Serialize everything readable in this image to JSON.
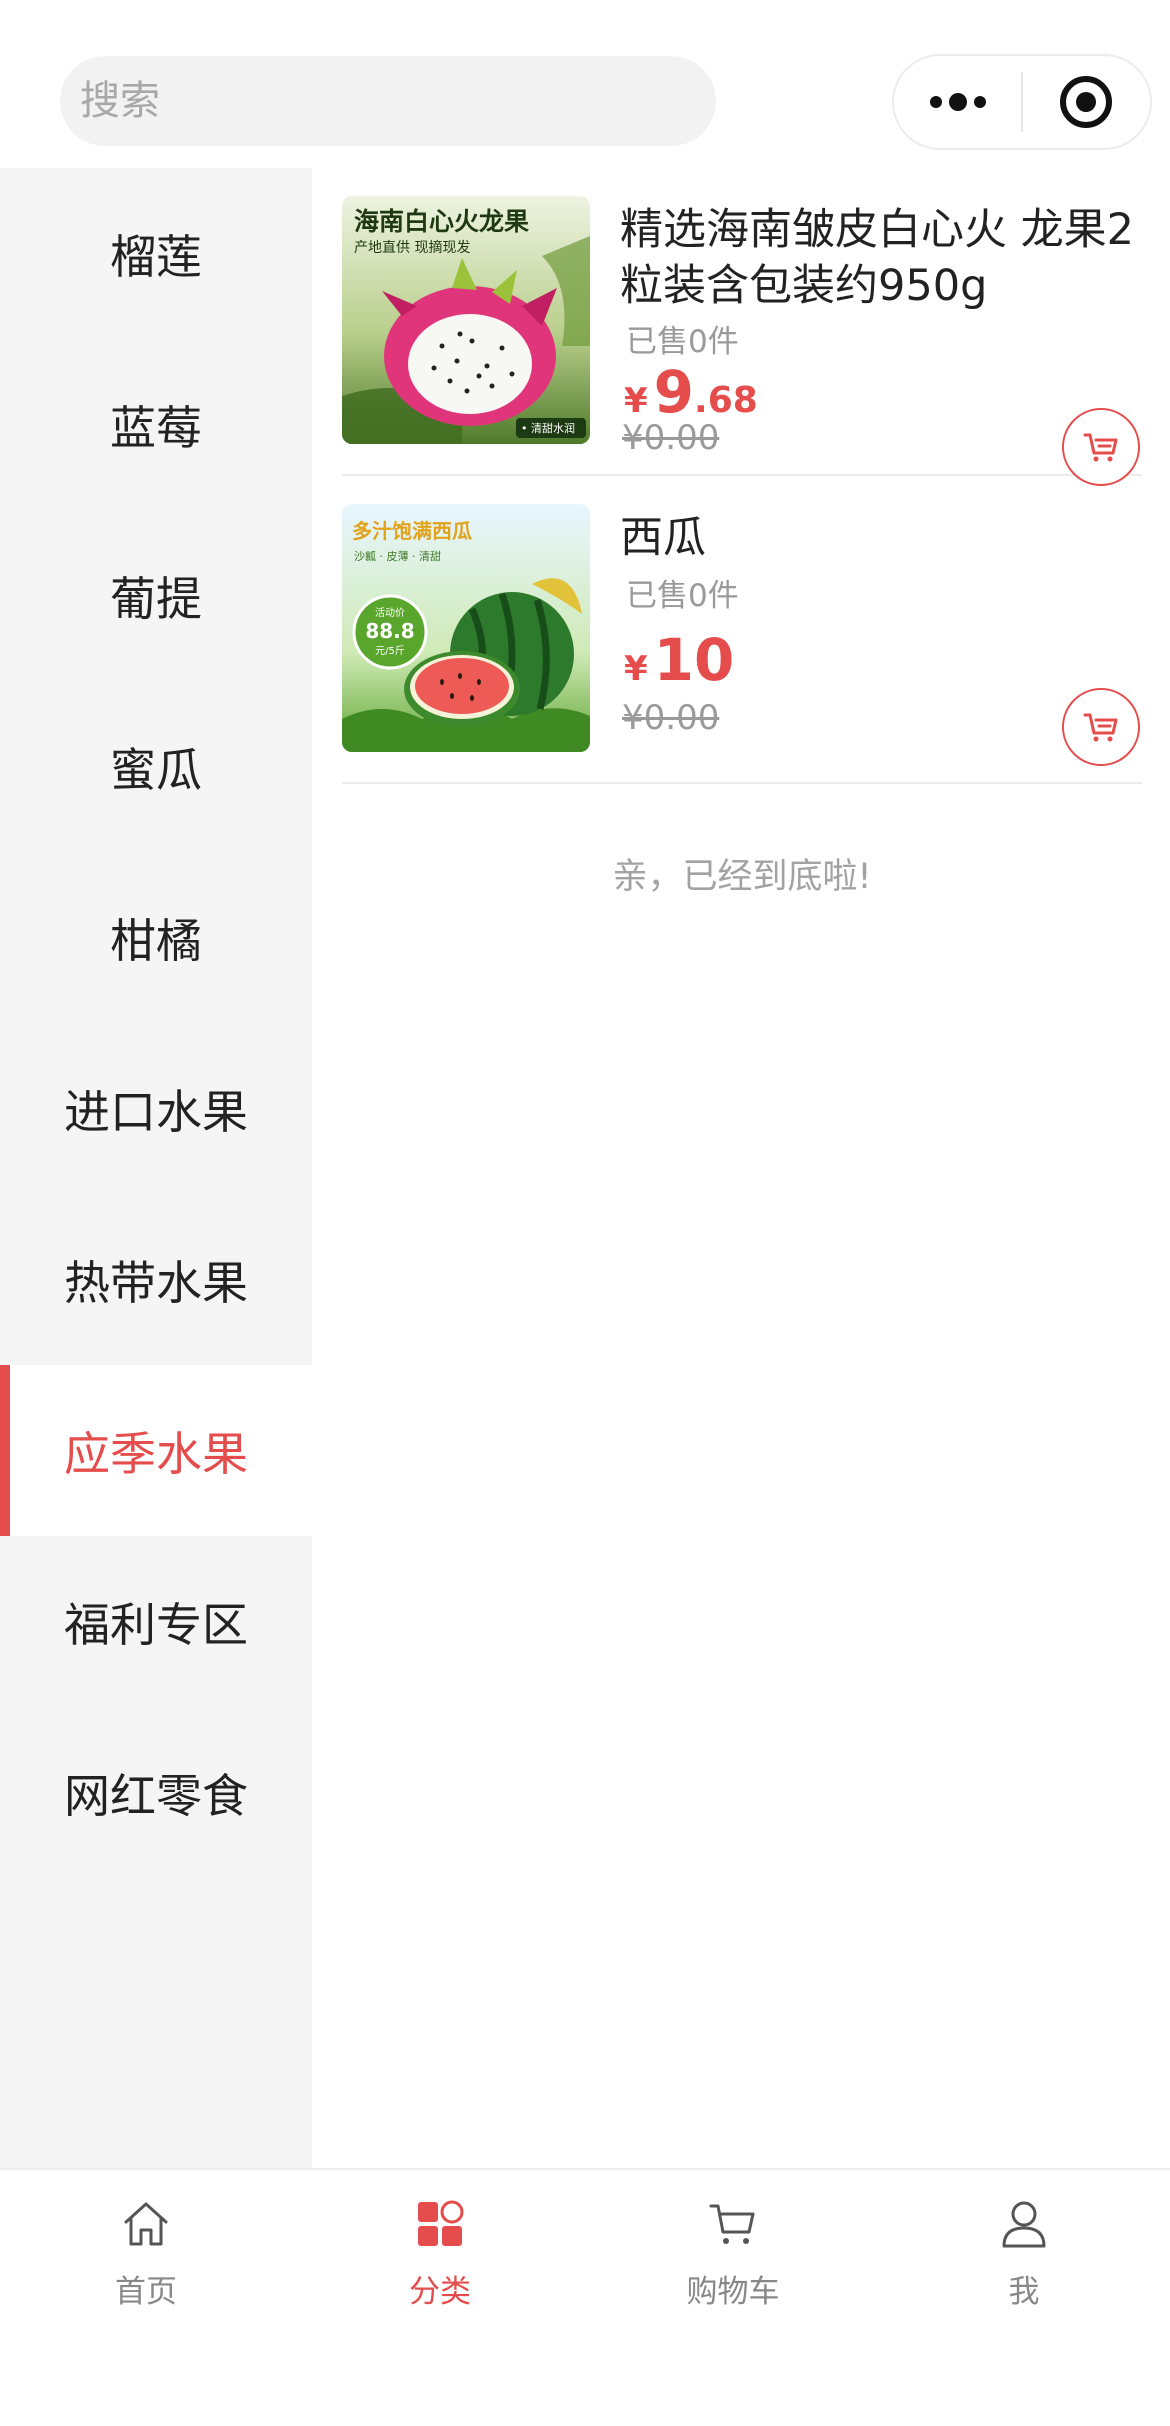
{
  "search": {
    "placeholder": "搜索"
  },
  "sidebar": {
    "items": [
      {
        "label": "榴莲"
      },
      {
        "label": "蓝莓"
      },
      {
        "label": "葡提"
      },
      {
        "label": "蜜瓜"
      },
      {
        "label": "柑橘"
      },
      {
        "label": "进口水果"
      },
      {
        "label": "热带水果"
      },
      {
        "label": "应季水果"
      },
      {
        "label": "福利专区"
      },
      {
        "label": "网红零食"
      }
    ],
    "active_label": "应季水果"
  },
  "products": [
    {
      "title": "精选海南皱皮白心火 龙果2粒装含包装约950g",
      "sold": "已售0件",
      "currency": "¥",
      "price_int": "9",
      "price_dec": ".68",
      "original_price": "¥0.00",
      "image": {
        "headline": "海南白心火龙果",
        "subline": "产地直供 现摘现发",
        "tag": "• 清甜水润"
      }
    },
    {
      "title": "西瓜",
      "sold": "已售0件",
      "currency": "¥",
      "price_int": "10",
      "price_dec": "",
      "original_price": "¥0.00",
      "image": {
        "headline": "多汁饱满西瓜",
        "subline": "沙瓤 · 皮薄 · 清甜",
        "badge_top": "活动价",
        "badge_value": "88.8",
        "badge_unit": "元/5斤"
      }
    }
  ],
  "list_end_note": "亲，已经到底啦!",
  "tabbar": {
    "tabs": [
      {
        "label": "首页",
        "icon": "home-icon"
      },
      {
        "label": "分类",
        "icon": "category-icon"
      },
      {
        "label": "购物车",
        "icon": "cart-icon"
      },
      {
        "label": "我",
        "icon": "user-icon"
      }
    ],
    "active_label": "分类"
  },
  "colors": {
    "accent": "#e54d4d",
    "sidebar_bg": "#f5f5f5",
    "muted_text": "#9a9a9a"
  }
}
